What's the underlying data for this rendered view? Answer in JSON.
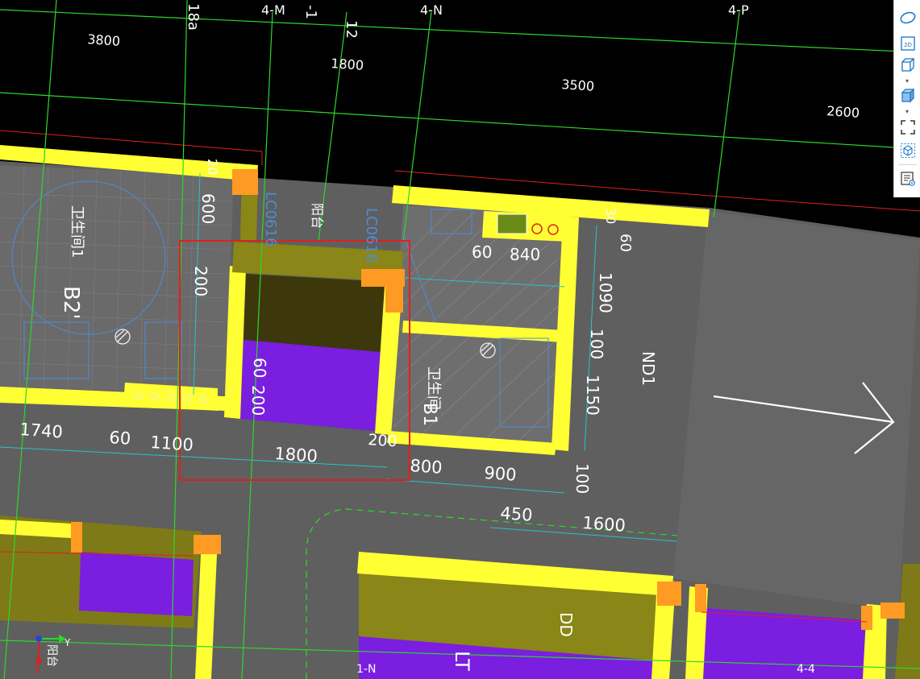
{
  "colors": {
    "background": "#000000",
    "wall_yellow": "#ffff33",
    "floor_gray": "#5c5c5c",
    "column_orange": "#ff9a22",
    "slab_purple": "#7a1ee0",
    "slab_olive": "#8c8a1e",
    "slab_dark_olive": "#3e3a0e",
    "axis_green": "#2bd82b",
    "dim_cyan": "#27c3c7",
    "selection_red": "#e0201c",
    "toolbar_icon": "#1a73c7"
  },
  "axis_labels": [
    "18a",
    "4-M",
    "-1",
    "4-N",
    "4-P",
    "12",
    "1-N",
    "4-4"
  ],
  "dimensions_top": [
    "3800",
    "1800",
    "3500",
    "2600"
  ],
  "dimensions_plan": [
    "600",
    "200",
    "60",
    "840",
    "1090",
    "100",
    "1150",
    "60",
    "200",
    "1740",
    "60",
    "1100",
    "1800",
    "200",
    "800",
    "900",
    "100",
    "450",
    "1600",
    "60",
    "20",
    "30"
  ],
  "room_labels": [
    "卫生间1",
    "B2'",
    "B1",
    "卫生间",
    "ND1",
    "DD",
    "LT",
    "LC0616",
    "阳台"
  ],
  "compass": {
    "y": "Y",
    "x": "X",
    "note": "阳台"
  },
  "toolbar": {
    "items": [
      {
        "name": "home-view-icon"
      },
      {
        "name": "2d-view-icon",
        "label": "2D"
      },
      {
        "name": "3d-box-view-icon"
      },
      {
        "name": "solid-view-icon"
      },
      {
        "name": "fullscreen-icon"
      },
      {
        "name": "section-box-icon"
      },
      {
        "name": "properties-icon"
      }
    ]
  }
}
